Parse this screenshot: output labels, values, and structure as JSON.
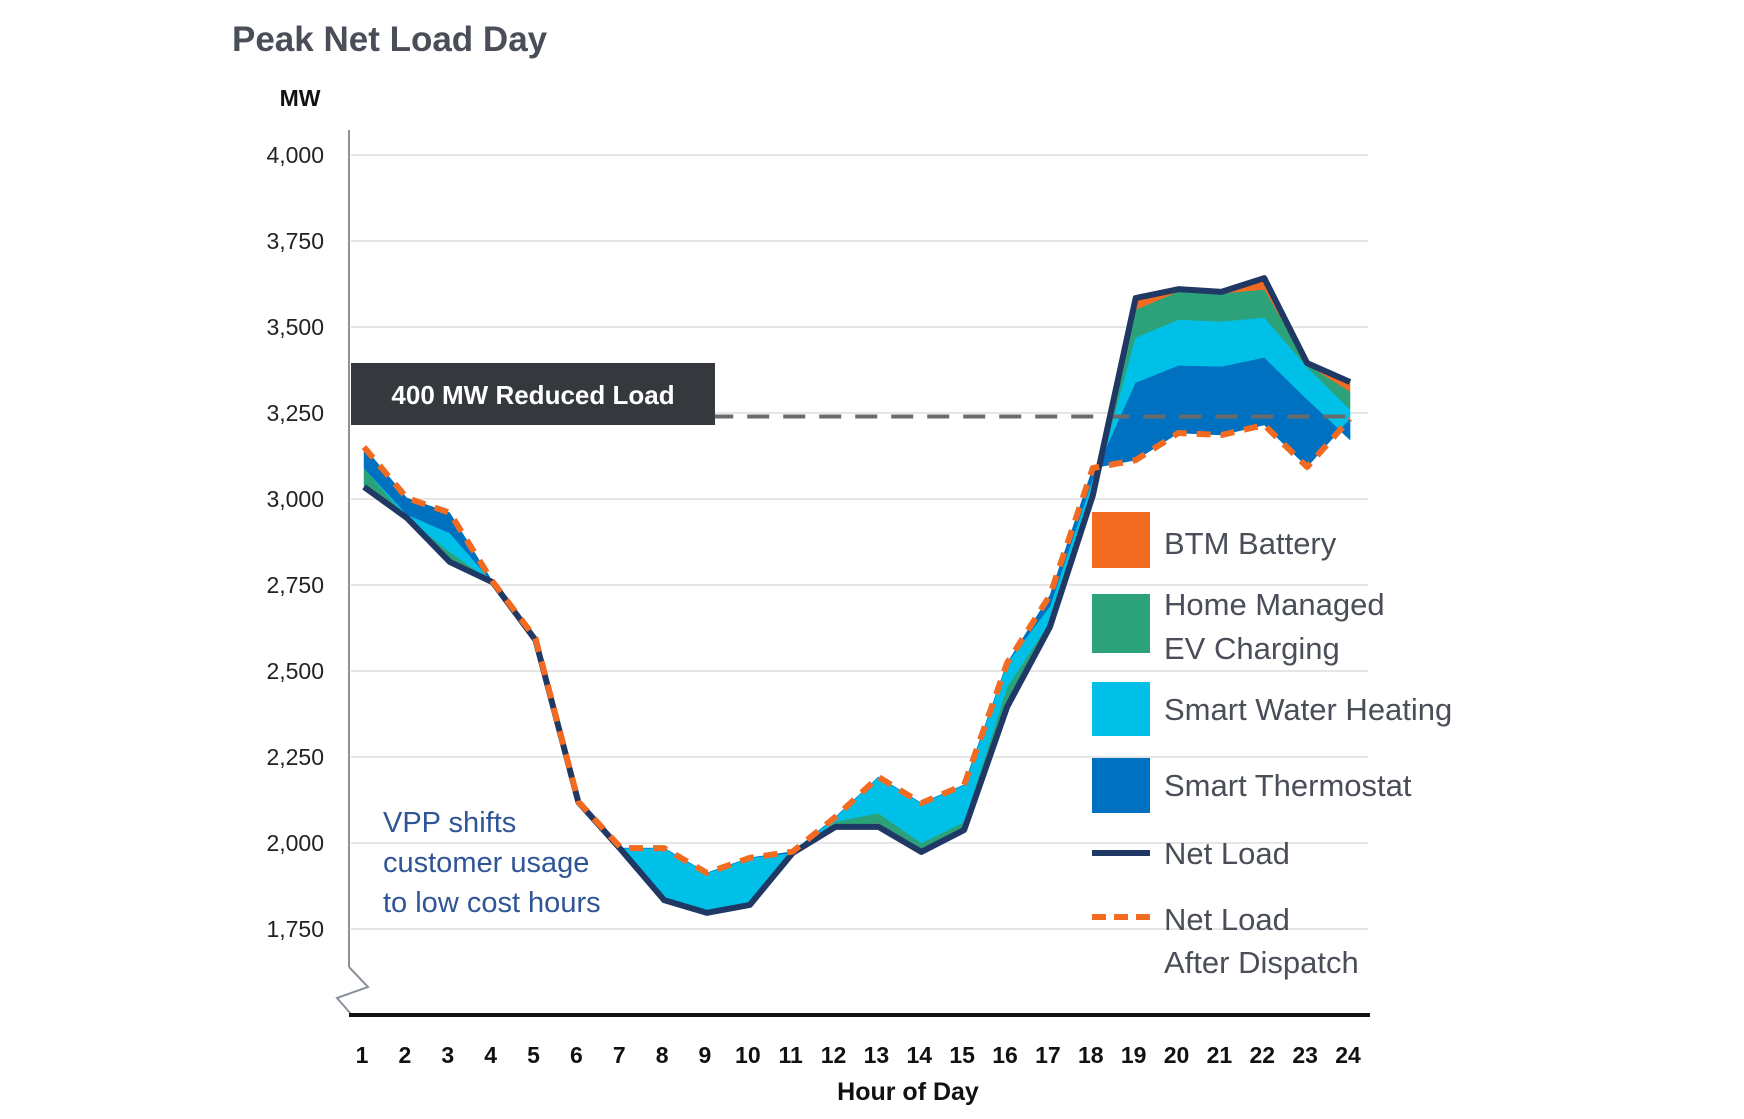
{
  "chart_data": {
    "type": "area",
    "title": "Peak Net Load Day",
    "ylabel": "MW",
    "xlabel": "Hour of Day",
    "ylim": [
      1750,
      4000
    ],
    "y_ticks": [
      4000,
      3750,
      3500,
      3250,
      3000,
      2750,
      2500,
      2250,
      2000,
      1750
    ],
    "y_tick_labels": [
      "4,000",
      "3,750",
      "3,500",
      "3,250",
      "3,000",
      "2,750",
      "2,500",
      "2,250",
      "2,000",
      "1,750"
    ],
    "y_axis_break": true,
    "grid": true,
    "categories": [
      "1",
      "2",
      "3",
      "4",
      "5",
      "6",
      "7",
      "8",
      "9",
      "10",
      "11",
      "12",
      "13",
      "14",
      "15",
      "16",
      "17",
      "18",
      "19",
      "20",
      "21",
      "22",
      "23",
      "24"
    ],
    "net_load": [
      3035,
      2945,
      2817,
      2758,
      2590,
      2119,
      1980,
      1834,
      1797,
      1820,
      1971,
      2047,
      2047,
      1974,
      2038,
      2395,
      2628,
      3010,
      3584,
      3610,
      3602,
      3642,
      3395,
      3340
    ],
    "stack_order_note": "resource reductions stacked downward from Net Load; negative = load shifted in",
    "series": [
      {
        "name": "BTM Battery",
        "color": "#f26b21",
        "values": [
          0,
          0,
          0,
          0,
          0,
          0,
          0,
          -10,
          0,
          0,
          0,
          -5,
          -10,
          -5,
          -5,
          -10,
          0,
          0,
          35,
          8,
          6,
          34,
          5,
          29
        ]
      },
      {
        "name": "Home Managed EV Charging",
        "color": "#2ca27a",
        "values": [
          -55,
          0,
          -29,
          0,
          0,
          0,
          0,
          0,
          0,
          0,
          0,
          -10,
          -30,
          -21,
          -18,
          -48,
          -15,
          0,
          81,
          82,
          81,
          82,
          9,
          52
        ]
      },
      {
        "name": "Smart Water Heating",
        "color": "#00c0e8",
        "values": [
          0,
          -10,
          -55,
          0,
          0,
          0,
          -5,
          -141,
          -116,
          -137,
          0,
          -14,
          -105,
          -116,
          -108,
          -70,
          -45,
          -50,
          131,
          133,
          131,
          116,
          93,
          87
        ]
      },
      {
        "name": "Smart Thermostat",
        "color": "#0070c0",
        "values": [
          -61,
          -48,
          -59,
          -2,
          -5,
          -1,
          0,
          0,
          0,
          0,
          -4,
          0,
          0,
          0,
          0,
          0,
          -32,
          -30,
          224,
          195,
          198,
          195,
          195,
          -61
        ]
      }
    ],
    "lines": [
      {
        "name": "Net Load",
        "color": "#1f3864",
        "style": "solid"
      },
      {
        "name": "Net Load After Dispatch",
        "color": "#f26b21",
        "style": "dashed"
      }
    ],
    "reference_line": {
      "value": 3240,
      "from_hour": 9.1,
      "to_hour": 24,
      "color": "#666666",
      "style": "dashed"
    },
    "annotations": [
      {
        "text": "400 MW Reduced Load",
        "kind": "label-box"
      },
      {
        "text_lines": [
          "VPP shifts",
          "customer usage",
          "to low cost hours"
        ],
        "kind": "note"
      }
    ],
    "legend": {
      "position": "right-middle",
      "entries": [
        {
          "label_lines": [
            "BTM Battery"
          ],
          "swatch": "box",
          "color": "#f26b21"
        },
        {
          "label_lines": [
            "Home Managed",
            "EV Charging"
          ],
          "swatch": "box",
          "color": "#2ca27a"
        },
        {
          "label_lines": [
            "Smart Water Heating"
          ],
          "swatch": "box",
          "color": "#00c0e8"
        },
        {
          "label_lines": [
            "Smart Thermostat"
          ],
          "swatch": "box",
          "color": "#0070c0"
        },
        {
          "label_lines": [
            "Net Load"
          ],
          "swatch": "line",
          "color": "#1f3864"
        },
        {
          "label_lines": [
            "Net Load",
            "After Dispatch"
          ],
          "swatch": "dashed",
          "color": "#f26b21"
        }
      ]
    }
  }
}
